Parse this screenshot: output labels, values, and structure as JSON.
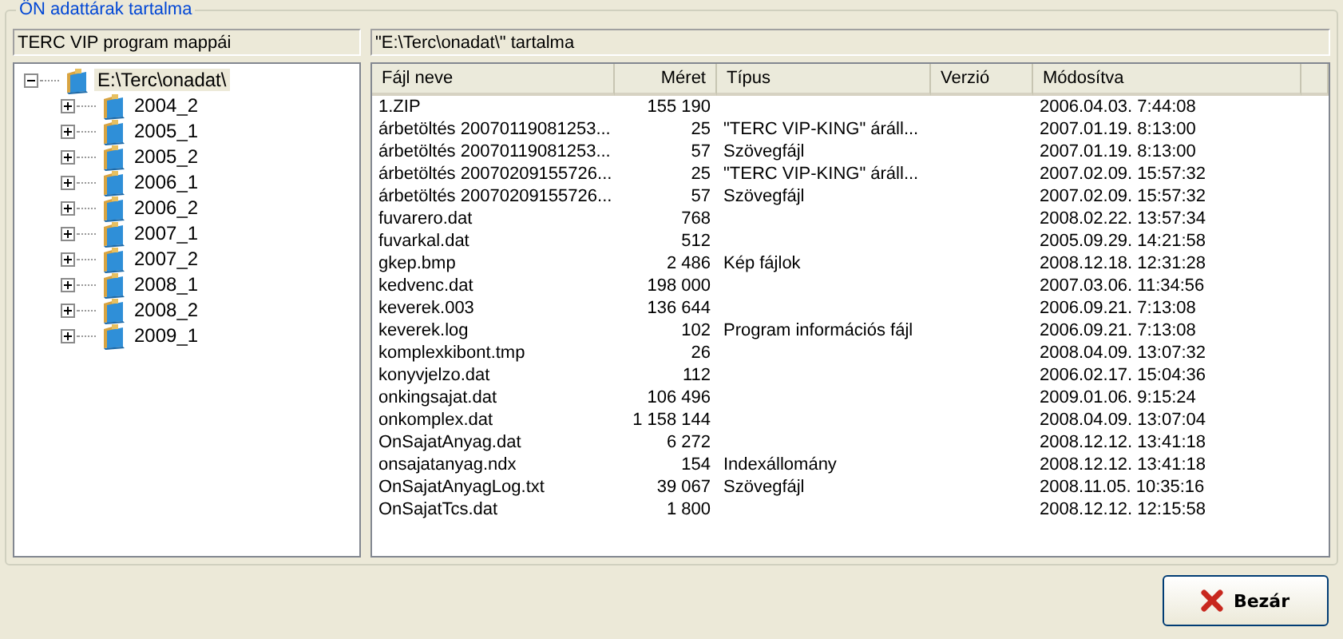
{
  "group": {
    "title": "ÖN adattárak tartalma"
  },
  "left_panel": {
    "caption": "TERC VIP program mappái",
    "tree": [
      {
        "label": "E:\\Terc\\onadat\\",
        "expanded": true,
        "selected": true,
        "children": [
          {
            "label": "2004_2",
            "expanded": false,
            "selected": false
          },
          {
            "label": "2005_1",
            "expanded": false,
            "selected": false
          },
          {
            "label": "2005_2",
            "expanded": false,
            "selected": false
          },
          {
            "label": "2006_1",
            "expanded": false,
            "selected": false
          },
          {
            "label": "2006_2",
            "expanded": false,
            "selected": false
          },
          {
            "label": "2007_1",
            "expanded": false,
            "selected": false
          },
          {
            "label": "2007_2",
            "expanded": false,
            "selected": false
          },
          {
            "label": "2008_1",
            "expanded": false,
            "selected": false
          },
          {
            "label": "2008_2",
            "expanded": false,
            "selected": false
          },
          {
            "label": "2009_1",
            "expanded": false,
            "selected": false
          }
        ]
      }
    ]
  },
  "right_panel": {
    "caption": "\"E:\\Terc\\onadat\\\" tartalma",
    "table": {
      "columns": [
        {
          "label": "Fájl neve"
        },
        {
          "label": "Méret"
        },
        {
          "label": "Típus"
        },
        {
          "label": "Verzió"
        },
        {
          "label": "Módosítva"
        }
      ],
      "rows": [
        [
          "1.ZIP",
          "155 190",
          "",
          "",
          "2006.04.03. 7:44:08"
        ],
        [
          "árbetöltés 20070119081253...",
          "25",
          "\"TERC VIP-KING\" áráll...",
          "",
          "2007.01.19. 8:13:00"
        ],
        [
          "árbetöltés 20070119081253...",
          "57",
          "Szövegfájl",
          "",
          "2007.01.19. 8:13:00"
        ],
        [
          "árbetöltés 20070209155726...",
          "25",
          "\"TERC VIP-KING\" áráll...",
          "",
          "2007.02.09. 15:57:32"
        ],
        [
          "árbetöltés 20070209155726...",
          "57",
          "Szövegfájl",
          "",
          "2007.02.09. 15:57:32"
        ],
        [
          "fuvarero.dat",
          "768",
          "",
          "",
          "2008.02.22. 13:57:34"
        ],
        [
          "fuvarkal.dat",
          "512",
          "",
          "",
          "2005.09.29. 14:21:58"
        ],
        [
          "gkep.bmp",
          "2 486",
          "Kép fájlok",
          "",
          "2008.12.18. 12:31:28"
        ],
        [
          "kedvenc.dat",
          "198 000",
          "",
          "",
          "2007.03.06. 11:34:56"
        ],
        [
          "keverek.003",
          "136 644",
          "",
          "",
          "2006.09.21. 7:13:08"
        ],
        [
          "keverek.log",
          "102",
          "Program információs fájl",
          "",
          "2006.09.21. 7:13:08"
        ],
        [
          "komplexkibont.tmp",
          "26",
          "",
          "",
          "2008.04.09. 13:07:32"
        ],
        [
          "konyvjelzo.dat",
          "112",
          "",
          "",
          "2006.02.17. 15:04:36"
        ],
        [
          "onkingsajat.dat",
          "106 496",
          "",
          "",
          "2009.01.06. 9:15:24"
        ],
        [
          "onkomplex.dat",
          "1 158 144",
          "",
          "",
          "2008.04.09. 13:07:04"
        ],
        [
          "OnSajatAnyag.dat",
          "6 272",
          "",
          "",
          "2008.12.12. 13:41:18"
        ],
        [
          "onsajatanyag.ndx",
          "154",
          "Indexállomány",
          "",
          "2008.12.12. 13:41:18"
        ],
        [
          "OnSajatAnyagLog.txt",
          "39 067",
          "Szövegfájl",
          "",
          "2008.11.05. 10:35:16"
        ],
        [
          "OnSajatTcs.dat",
          "1 800",
          "",
          "",
          "2008.12.12. 12:15:58"
        ]
      ]
    }
  },
  "buttons": [
    {
      "label": "Bezár",
      "kind": "close"
    }
  ]
}
